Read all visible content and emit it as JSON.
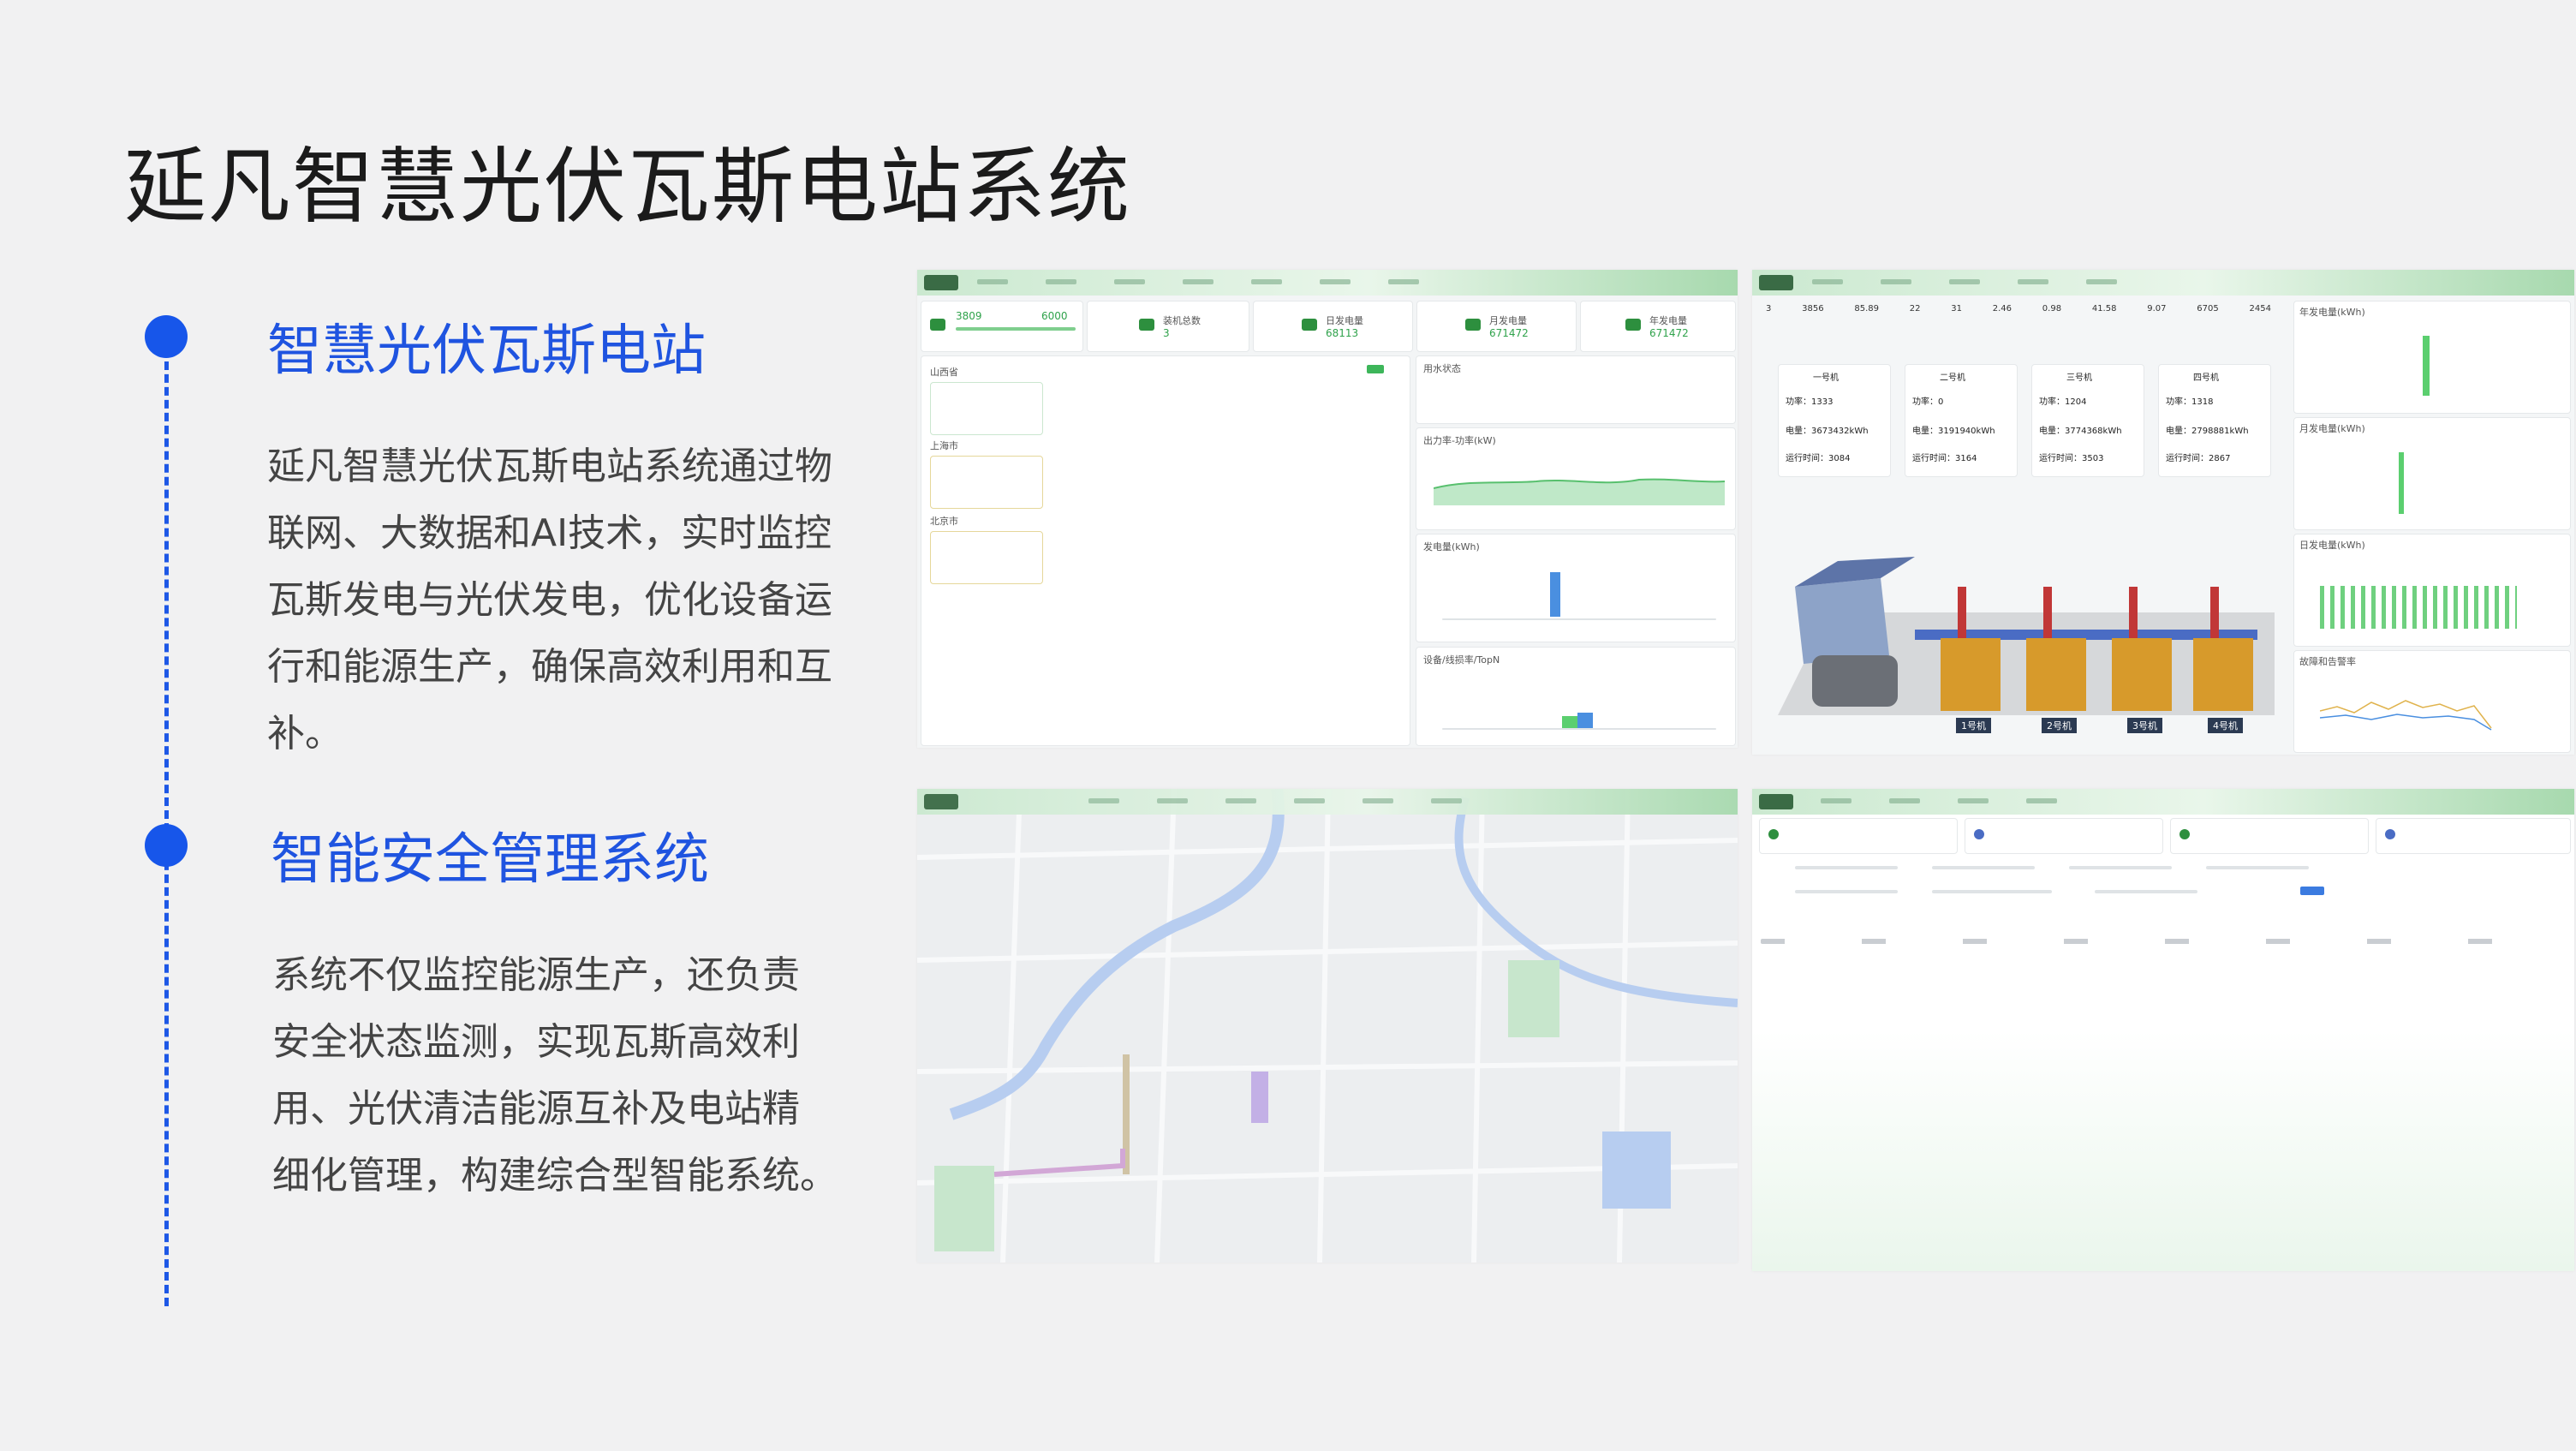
{
  "title": "延凡智慧光伏瓦斯电站系统",
  "sections": [
    {
      "heading": "智慧光伏瓦斯电站",
      "lines": [
        "延凡智慧光伏瓦斯电站系统通过物",
        "联网、大数据和AI技术，实时监控",
        "瓦斯发电与光伏发电，优化设备运",
        "行和能源生产，确保高效利用和互",
        "补。"
      ]
    },
    {
      "heading": "智能安全管理系统",
      "lines": [
        "系统不仅监控能源生产，还负责",
        "安全状态监测，实现瓦斯高效利",
        "用、光伏清洁能源互补及电站精",
        "细化管理，构建综合型智能系统。"
      ]
    }
  ],
  "colors": {
    "accent": "#1f54e0",
    "green": "#2fa24b",
    "blue": "#4a8fe0",
    "bar_green": "#5bcf6f"
  },
  "screens": {
    "dashboard": {
      "kpis": [
        {
          "a": "3809",
          "b": "6000"
        },
        {
          "label": "装机总数",
          "value": "3"
        },
        {
          "label": "日发电量",
          "value": "68113"
        },
        {
          "label": "月发电量",
          "value": "671472"
        },
        {
          "label": "年发电量",
          "value": "671472"
        }
      ],
      "sites": [
        "山西省",
        "上海市",
        "北京市"
      ],
      "panel_titles": [
        "用水状态",
        "出力率-功率(kW)",
        "发电量(kWh)",
        "设备/线损率/TopN"
      ]
    },
    "units": {
      "machines": [
        {
          "name": "一号机",
          "power": "功率：1333",
          "energy": "电量：3673432kWh",
          "runtime": "运行时间：3084"
        },
        {
          "name": "二号机",
          "power": "功率：0",
          "energy": "电量：3191940kWh",
          "runtime": "运行时间：3164"
        },
        {
          "name": "三号机",
          "power": "功率：1204",
          "energy": "电量：3774368kWh",
          "runtime": "运行时间：3503"
        },
        {
          "name": "四号机",
          "power": "功率：1318",
          "energy": "电量：2798881kWh",
          "runtime": "运行时间：2867"
        }
      ],
      "unit_labels": [
        "1号机",
        "2号机",
        "3号机",
        "4号机"
      ],
      "stats": [
        "3",
        "3856",
        "85.89",
        "22",
        "31",
        "2.46",
        "0.98",
        "41.58",
        "9.07",
        "6705",
        "2454"
      ],
      "right_titles": [
        "年发电量(kWh)",
        "月发电量(kWh)",
        "日发电量(kWh)",
        "故障和告警率"
      ]
    }
  }
}
